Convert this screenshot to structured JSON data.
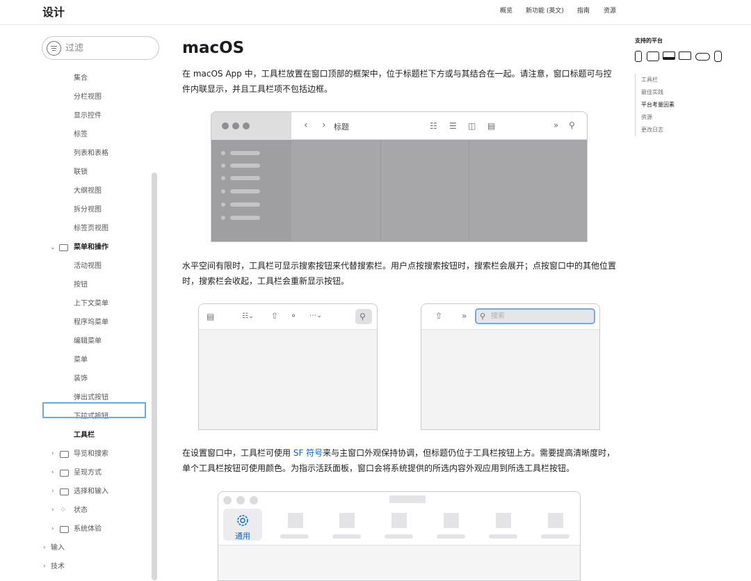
{
  "nav": {
    "brand": "设计",
    "links": [
      "概览",
      "新功能 (英文)",
      "指南",
      "资源"
    ]
  },
  "sidebar": {
    "filter_placeholder": "过滤",
    "items": [
      {
        "label": "集合",
        "level": 2
      },
      {
        "label": "分栏视图",
        "level": 2
      },
      {
        "label": "显示控件",
        "level": 2
      },
      {
        "label": "标签",
        "level": 2
      },
      {
        "label": "列表和表格",
        "level": 2
      },
      {
        "label": "联锁",
        "level": 2
      },
      {
        "label": "大纲视图",
        "level": 2
      },
      {
        "label": "拆分视图",
        "level": 2
      },
      {
        "label": "标签页视图",
        "level": 2
      },
      {
        "label": "菜单和操作",
        "level": 1,
        "expanded": true
      },
      {
        "label": "活动视图",
        "level": 2
      },
      {
        "label": "按钮",
        "level": 2
      },
      {
        "label": "上下文菜单",
        "level": 2
      },
      {
        "label": "程序坞菜单",
        "level": 2
      },
      {
        "label": "编辑菜单",
        "level": 2
      },
      {
        "label": "菜单",
        "level": 2
      },
      {
        "label": "装饰",
        "level": 2
      },
      {
        "label": "弹出式按钮",
        "level": 2
      },
      {
        "label": "下拉式按钮",
        "level": 2
      },
      {
        "label": "工具栏",
        "level": 2,
        "selected": true
      },
      {
        "label": "导览和搜索",
        "level": 1,
        "icon": "sidebar-icon"
      },
      {
        "label": "呈现方式",
        "level": 1,
        "icon": "windows-icon"
      },
      {
        "label": "选择和输入",
        "level": 1,
        "icon": "keyboard-icon"
      },
      {
        "label": "状态",
        "level": 1,
        "icon": "spinner-icon"
      },
      {
        "label": "系统体验",
        "level": 1,
        "icon": "menubar-icon"
      },
      {
        "label": "输入",
        "level": 0
      },
      {
        "label": "技术",
        "level": 0
      }
    ]
  },
  "main": {
    "title": "macOS",
    "para1": "在 macOS App 中，工具栏放置在窗口顶部的框架中，位于标题栏下方或与其结合在一起。请注意，窗口标题可与控件内联显示，并且工具栏项不包括边框。",
    "para2": "水平空间有限时，工具栏可显示搜索按钮来代替搜索栏。用户点按搜索按钮时，搜索栏会展开；点按窗口中的其他位置时，搜索栏会收起，工具栏会重新显示按钮。",
    "para3_before": "在设置窗口中，工具栏可使用 ",
    "para3_link": "SF 符号",
    "para3_after": "来与主窗口外观保持协调，但标题仍位于工具栏按钮上方。需要提高清晰度时，单个工具栏按钮可使用颜色。为指示活跃面板，窗口会将系统提供的所选内容外观应用到所选工具栏按钮。"
  },
  "figure1": {
    "window_title": "标题"
  },
  "figure2": {
    "search_placeholder": "搜索"
  },
  "figure3": {
    "selected_tab": "通用"
  },
  "toc": {
    "title": "支持的平台",
    "platforms": [
      "iphone-icon",
      "ipad-icon",
      "mac-icon",
      "tv-icon",
      "vision-icon",
      "watch-icon"
    ],
    "items": [
      "工具栏",
      "最佳实践",
      "平台考量因素",
      "资源",
      "更改日志"
    ],
    "active": "平台考量因素"
  },
  "colors": {
    "link": "#0066cc",
    "selection_outline": "#69a9e6",
    "search_focus": "#7aa7dd"
  }
}
